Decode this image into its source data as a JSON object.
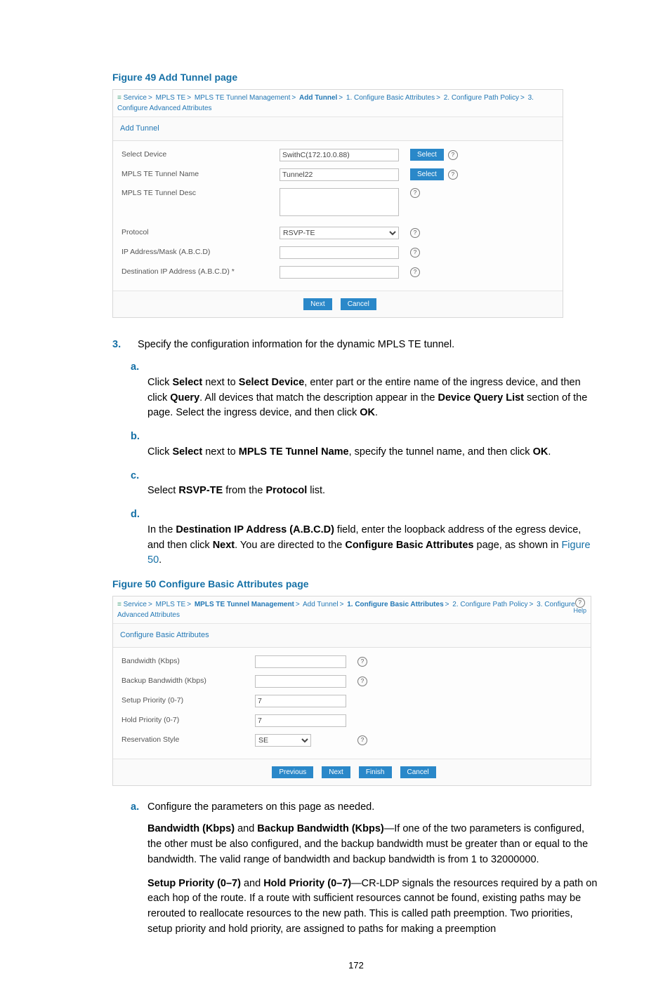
{
  "page_number": "172",
  "figure49": {
    "caption": "Figure 49 Add Tunnel page",
    "crumb": [
      "Service",
      "MPLS TE",
      "MPLS TE Tunnel Management",
      "Add Tunnel",
      "1. Configure Basic Attributes",
      "2. Configure Path Policy",
      "3. Configure Advanced Attributes"
    ],
    "crumb_bold_index": 3,
    "panel_title": "Add Tunnel",
    "rows": {
      "select_device": {
        "label": "Select Device",
        "value": "SwithC(172.10.0.88)",
        "select_btn": "Select"
      },
      "tunnel_name": {
        "label": "MPLS TE Tunnel Name",
        "value": "Tunnel22",
        "select_btn": "Select"
      },
      "tunnel_desc": {
        "label": "MPLS TE Tunnel Desc"
      },
      "protocol": {
        "label": "Protocol",
        "value": "RSVP-TE"
      },
      "ip_mask": {
        "label": "IP Address/Mask (A.B.C.D)"
      },
      "dest_ip": {
        "label": "Destination IP Address (A.B.C.D)  *"
      }
    },
    "buttons": {
      "next": "Next",
      "cancel": "Cancel"
    }
  },
  "body1": {
    "step3": "Specify the configuration information for the dynamic MPLS TE tunnel.",
    "a": {
      "p1a": "Click ",
      "p1b": "Select",
      "p1c": " next to ",
      "p1d": "Select Device",
      "p1e": ", enter part or the entire name of the ingress device, and then click ",
      "p1f": "Query",
      "p1g": ". All devices that match the description appear in the ",
      "p1h": "Device Query List",
      "p1i": " section of the page. Select the ingress device, and then click ",
      "p1j": "OK",
      "p1k": "."
    },
    "b": {
      "p1a": "Click ",
      "p1b": "Select",
      "p1c": " next to ",
      "p1d": "MPLS TE Tunnel Name",
      "p1e": ", specify the tunnel name, and then click ",
      "p1f": "OK",
      "p1g": "."
    },
    "c": {
      "p1a": "Select ",
      "p1b": "RSVP-TE",
      "p1c": " from the ",
      "p1d": "Protocol",
      "p1e": " list."
    },
    "d": {
      "p1a": "In the ",
      "p1b": "Destination IP Address (A.B.C.D)",
      "p1c": " field, enter the loopback address of the egress device, and then click ",
      "p1d": "Next",
      "p1e": ". You are directed to the ",
      "p1f": "Configure Basic Attributes",
      "p1g": " page, as shown in ",
      "p1h": "Figure 50",
      "p1i": "."
    }
  },
  "figure50": {
    "caption": "Figure 50 Configure Basic Attributes page",
    "crumb": [
      "Service",
      "MPLS TE",
      "MPLS TE Tunnel Management",
      "Add Tunnel",
      "1. Configure Basic Attributes",
      "2. Configure Path Policy",
      "3. Configure Advanced Attributes"
    ],
    "crumb_bold_index": 4,
    "help_label": "Help",
    "panel_title": "Configure Basic Attributes",
    "rows": {
      "bw": {
        "label": "Bandwidth (Kbps)"
      },
      "bbw": {
        "label": "Backup Bandwidth (Kbps)"
      },
      "setup": {
        "label": "Setup Priority (0-7)",
        "value": "7"
      },
      "hold": {
        "label": "Hold Priority (0-7)",
        "value": "7"
      },
      "res": {
        "label": "Reservation Style",
        "value": "SE"
      }
    },
    "buttons": {
      "prev": "Previous",
      "next": "Next",
      "finish": "Finish",
      "cancel": "Cancel"
    }
  },
  "body2": {
    "a": "Configure the parameters on this page as needed.",
    "p1": {
      "b1": "Bandwidth (Kbps)",
      "mid": " and ",
      "b2": "Backup Bandwidth (Kbps)",
      "rest": "—If one of the two parameters is configured, the other must be also configured, and the backup bandwidth must be greater than or equal to the bandwidth. The valid range of bandwidth and backup bandwidth is from 1 to 32000000."
    },
    "p2": {
      "b1": "Setup Priority (0–7)",
      "mid": " and ",
      "b2": "Hold Priority (0–7)",
      "rest": "—CR-LDP signals the resources required by a path on each hop of the route. If a route with sufficient resources cannot be found, existing paths may be rerouted to reallocate resources to the new path. This is called path preemption. Two priorities, setup priority and hold priority, are assigned to paths for making a preemption"
    }
  }
}
